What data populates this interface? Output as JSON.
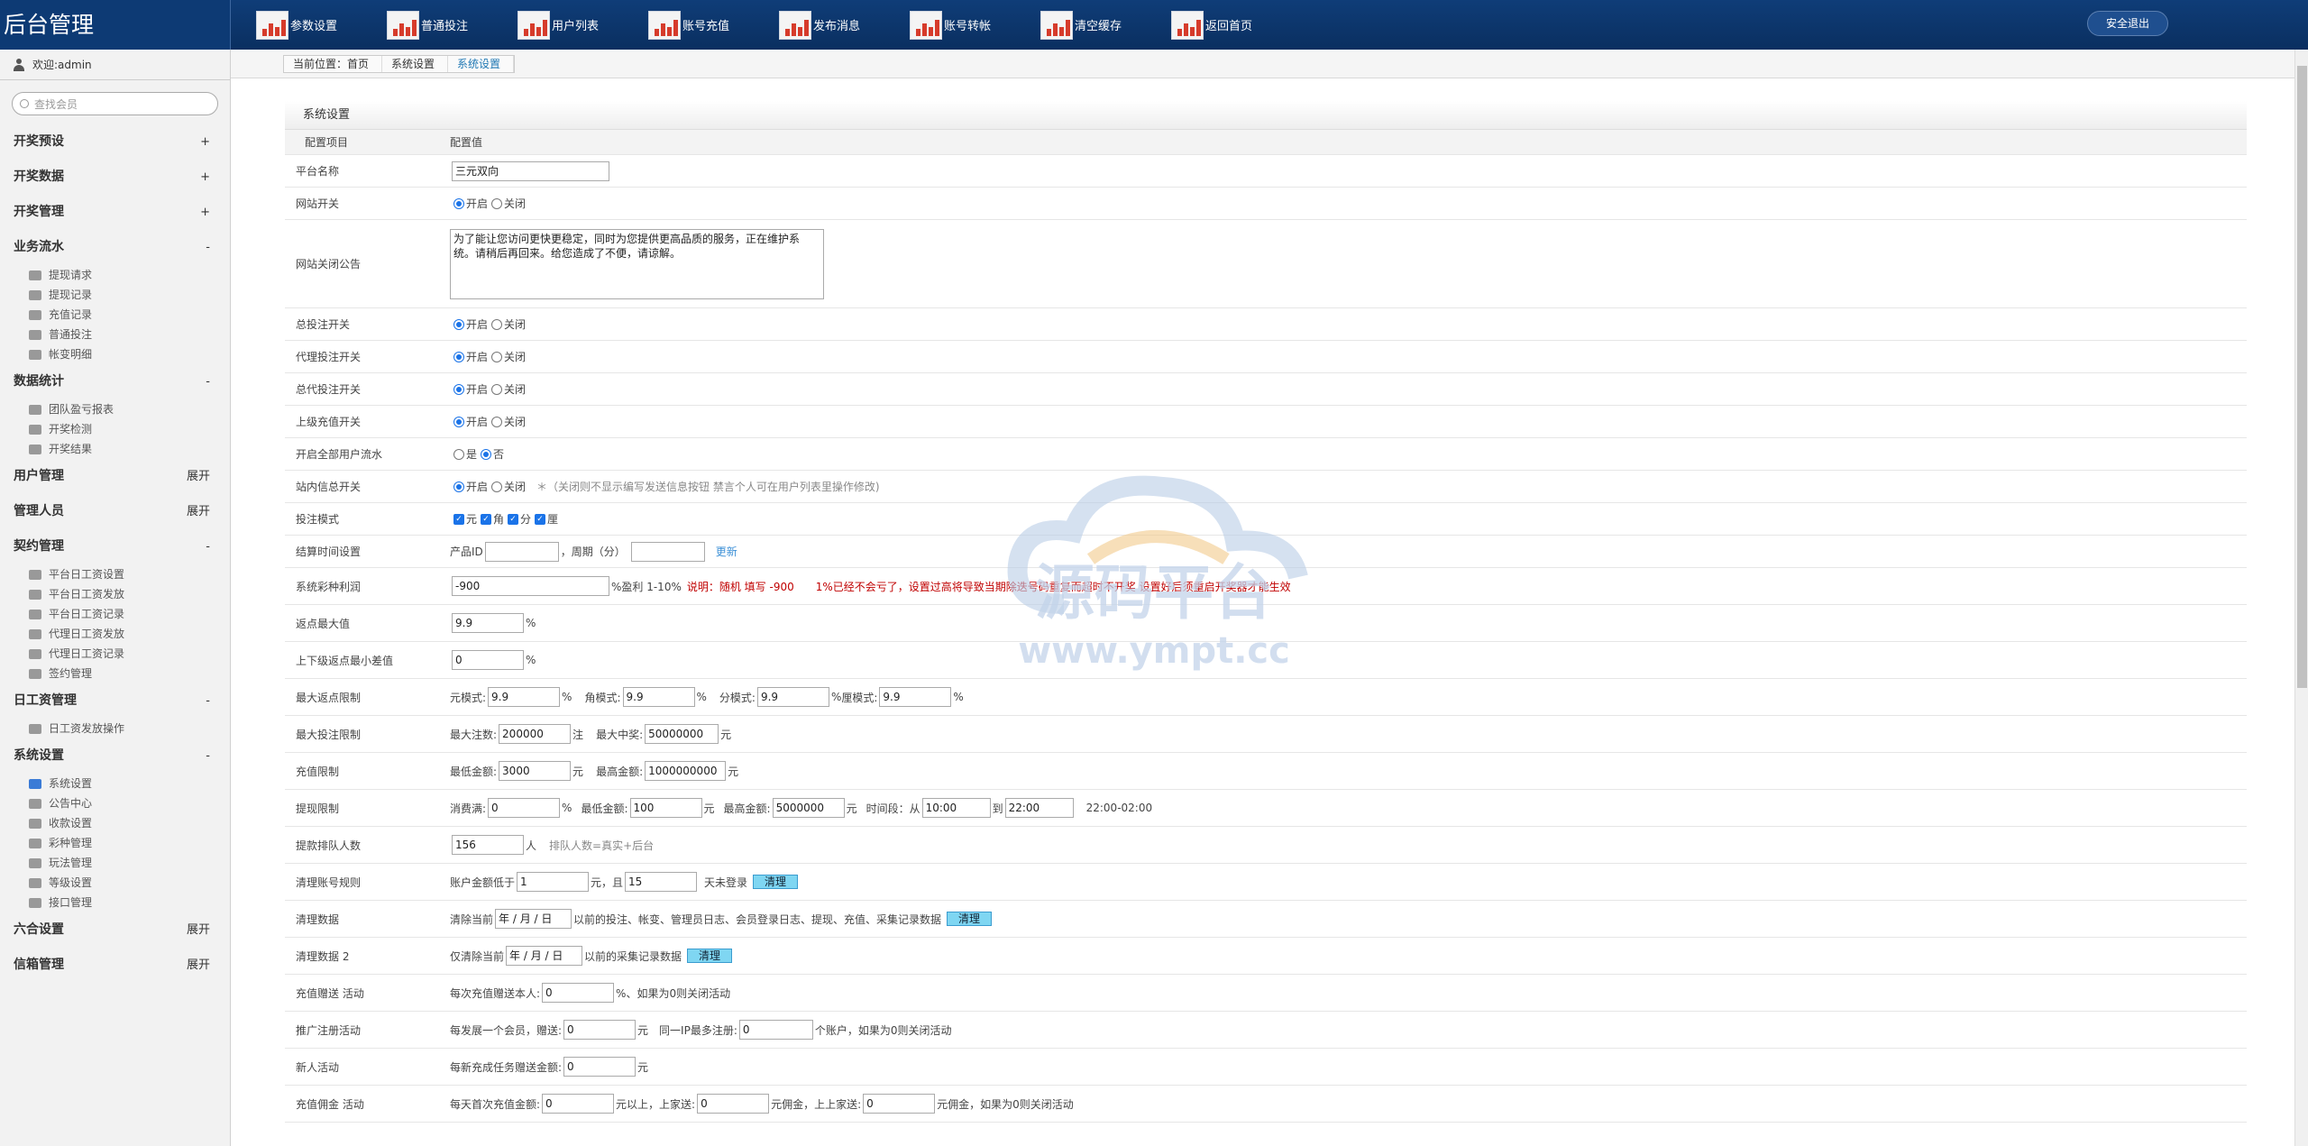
{
  "brand": "后台管理",
  "topnav": [
    "参数设置",
    "普通投注",
    "用户列表",
    "账号充值",
    "发布消息",
    "账号转帐",
    "清空缓存",
    "返回首页"
  ],
  "logout": "安全退出",
  "sidebar": {
    "welcome": "欢迎:admin",
    "search_placeholder": "查找会员",
    "groups": [
      {
        "label": "开奖预设",
        "toggle": "+"
      },
      {
        "label": "开奖数据",
        "toggle": "+"
      },
      {
        "label": "开奖管理",
        "toggle": "+"
      },
      {
        "label": "业务流水",
        "toggle": "-"
      },
      {
        "label": "数据统计",
        "toggle": "-"
      },
      {
        "label": "用户管理",
        "toggle": "展开"
      },
      {
        "label": "管理人员",
        "toggle": "展开"
      },
      {
        "label": "契约管理",
        "toggle": "-"
      },
      {
        "label": "日工资管理",
        "toggle": "-"
      },
      {
        "label": "系统设置",
        "toggle": "-"
      },
      {
        "label": "六合设置",
        "toggle": "展开"
      },
      {
        "label": "信箱管理",
        "toggle": "展开"
      }
    ],
    "biz": [
      "提现请求",
      "提现记录",
      "充值记录",
      "普通投注",
      "帐变明细"
    ],
    "stats": [
      "团队盈亏报表",
      "开奖检测",
      "开奖结果"
    ],
    "contract": [
      "平台日工资设置",
      "平台日工资发放",
      "平台日工资记录",
      "代理日工资发放",
      "代理日工资记录",
      "签约管理"
    ],
    "wage": [
      "日工资发放操作"
    ],
    "system": [
      "系统设置",
      "公告中心",
      "收款设置",
      "彩种管理",
      "玩法管理",
      "等级设置",
      "接口管理"
    ]
  },
  "breadcrumb": [
    "当前位置：首页",
    "系统设置",
    "系统设置"
  ],
  "section_title": "系统设置",
  "header": {
    "key": "配置项目",
    "value": "配置值"
  },
  "rows": {
    "platform_name": {
      "label": "平台名称",
      "value": "三元双向"
    },
    "site_switch": {
      "label": "网站开关",
      "on": "开启",
      "off": "关闭"
    },
    "close_notice": {
      "label": "网站关闭公告",
      "text": "为了能让您访问更快更稳定，同时为您提供更高品质的服务，正在维护系统。请稍后再回来。给您造成了不便，请谅解。"
    },
    "bet_switch": {
      "label": "总投注开关",
      "on": "开启",
      "off": "关闭"
    },
    "agent_bet": {
      "label": "代理投注开关",
      "on": "开启",
      "off": "关闭"
    },
    "gagent_bet": {
      "label": "总代投注开关",
      "on": "开启",
      "off": "关闭"
    },
    "upper_charge": {
      "label": "上级充值开关",
      "on": "开启",
      "off": "关闭"
    },
    "all_flow": {
      "label": "开启全部用户流水",
      "yes": "是",
      "no": "否"
    },
    "mail_switch": {
      "label": "站内信总开关",
      "on": "开启",
      "off": "关闭",
      "note": "＊（关闭则不显示编写发送信息按钮 禁言个人可在用户列表里操作修改)"
    },
    "bet_mode": {
      "label": "投注模式",
      "modes": [
        "元",
        "角",
        "分",
        "厘"
      ]
    },
    "settle_time": {
      "label": "结算时间设置",
      "pid": "产品ID",
      "period": "，周期（分）",
      "update": "更新"
    },
    "profit": {
      "label": "系统彩种利润",
      "value": "-900",
      "unit": "%盈利 1-10%",
      "note": "说明：随机 填写 -900　　1%已经不会亏了，设置过高将导致当期除迭号码重复而超时不开奖 设置好后须重启开奖器才能生效"
    },
    "rebate_max": {
      "label": "返点最大值",
      "value": "9.9",
      "unit": "%"
    },
    "rebate_diff": {
      "label": "上下级返点最小差值",
      "value": "0",
      "unit": "%"
    },
    "max_rebate": {
      "label": "最大返点限制",
      "items": [
        {
          "k": "元模式:",
          "v": "9.9",
          "u": "%"
        },
        {
          "k": "角模式:",
          "v": "9.9",
          "u": "%"
        },
        {
          "k": "分模式:",
          "v": "9.9",
          "u": "%"
        },
        {
          "k": "厘模式:",
          "v": "9.9",
          "u": "%"
        }
      ]
    },
    "max_bet": {
      "label": "最大投注限制",
      "count_k": "最大注数:",
      "count": "200000",
      "count_u": "注",
      "win_k": "最大中奖:",
      "win": "50000000",
      "win_u": "元"
    },
    "charge_limit": {
      "label": "充值限制",
      "min_k": "最低金额:",
      "min": "3000",
      "min_u": "元",
      "max_k": "最高金额:",
      "max": "1000000000",
      "max_u": "元"
    },
    "withdraw_limit": {
      "label": "提现限制",
      "cons_k": "消费满:",
      "cons": "0",
      "cons_u": "%",
      "min_k": "最低金额:",
      "min": "100",
      "min_u": "元",
      "max_k": "最高金额:",
      "max": "5000000",
      "max_u": "元",
      "time_k": "时间段：从",
      "t1": "10:00",
      "to": "到",
      "t2": "22:00",
      "range": "22:00-02:00"
    },
    "queue": {
      "label": "提款排队人数",
      "value": "156",
      "unit": "人",
      "note": "排队人数=真实+后台"
    },
    "clean_account": {
      "label": "清理账号规则",
      "k1": "账户金额低于",
      "v1": "1",
      "k2": "元，且",
      "v2": "15",
      "k3": "天未登录",
      "btn": "清理"
    },
    "clean_data": {
      "label": "清理数据",
      "k1": "清除当前",
      "date": "年 / 月 / 日",
      "k2": "以前的投注、帐变、管理员日志、会员登录日志、提现、充值、采集记录数据",
      "btn": "清理"
    },
    "clean_data2": {
      "label": "清理数据 2",
      "k1": "仅清除当前",
      "date": "年 / 月 / 日",
      "k2": "以前的采集记录数据",
      "btn": "清理"
    },
    "charge_gift": {
      "label": "充值赠送 活动",
      "k1": "每次充值赠送本人:",
      "v1": "0",
      "k2": "%、如果为0则关闭活动"
    },
    "promo_reg": {
      "label": "推广注册活动",
      "k1": "每发展一个会员，赠送:",
      "v1": "0",
      "k2": "元　同一IP最多注册:",
      "v2": "0",
      "k3": "个账户，如果为0则关闭活动"
    },
    "newbie": {
      "label": "新人活动",
      "k1": "每新充成任务赠送金额:",
      "v1": "0",
      "k2": "元"
    },
    "commission": {
      "label": "充值佣金 活动",
      "k1": "每天首次充值金额:",
      "v1": "0",
      "k2": "元以上，上家送:",
      "v2": "0",
      "k3": "元佣金，上上家送:",
      "v3": "0",
      "k4": "元佣金，如果为0则关闭活动"
    }
  },
  "watermark": {
    "title": "源码平台",
    "url": "www.ympt.cc"
  },
  "colors": {
    "topbar": "#0d3a74",
    "accent": "#1a73e8",
    "note_red": "#c00000"
  }
}
